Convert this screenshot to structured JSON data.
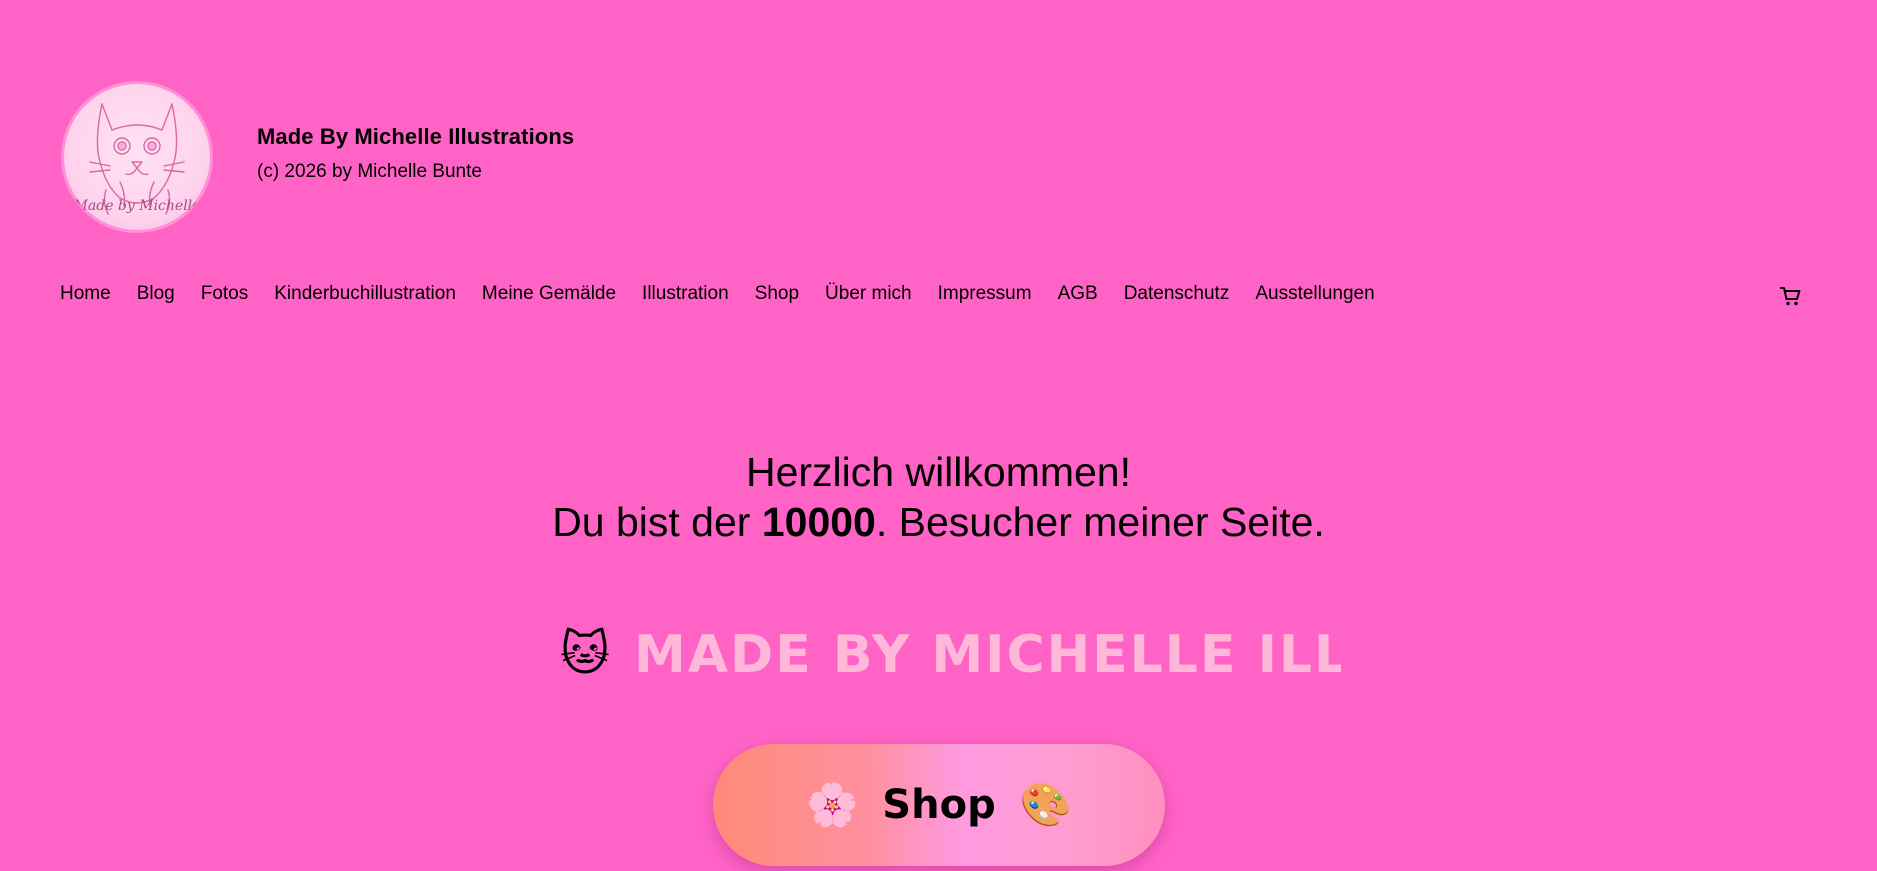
{
  "header": {
    "logo_text": "Made by Michelle",
    "site_title": "Made By Michelle Illustrations",
    "copyright": "(c) 2026 by Michelle Bunte"
  },
  "nav": {
    "items": [
      {
        "label": "Home"
      },
      {
        "label": "Blog"
      },
      {
        "label": "Fotos"
      },
      {
        "label": "Kinderbuchillustration"
      },
      {
        "label": "Meine Gemälde"
      },
      {
        "label": "Illustration"
      },
      {
        "label": "Shop"
      },
      {
        "label": "Über mich"
      },
      {
        "label": "Impressum"
      },
      {
        "label": "AGB"
      },
      {
        "label": "Datenschutz"
      },
      {
        "label": "Ausstellungen"
      }
    ],
    "cart_icon": "shopping-cart-icon"
  },
  "welcome": {
    "line1": "Herzlich willkommen!",
    "line2_prefix": "Du bist der ",
    "visitor_count": "10000",
    "line2_suffix": ". Besucher meiner Seite."
  },
  "marquee": {
    "emoji": "🐱",
    "text": "MADE BY MICHELLE ILLUSTRATIONS"
  },
  "shop_button": {
    "left_emoji": "🌸",
    "label": "Shop",
    "right_emoji": "🎨"
  },
  "colors": {
    "background": "#ff63c6",
    "marquee_text": "#ffb8da",
    "logo_bg": "#ffd5ee"
  }
}
